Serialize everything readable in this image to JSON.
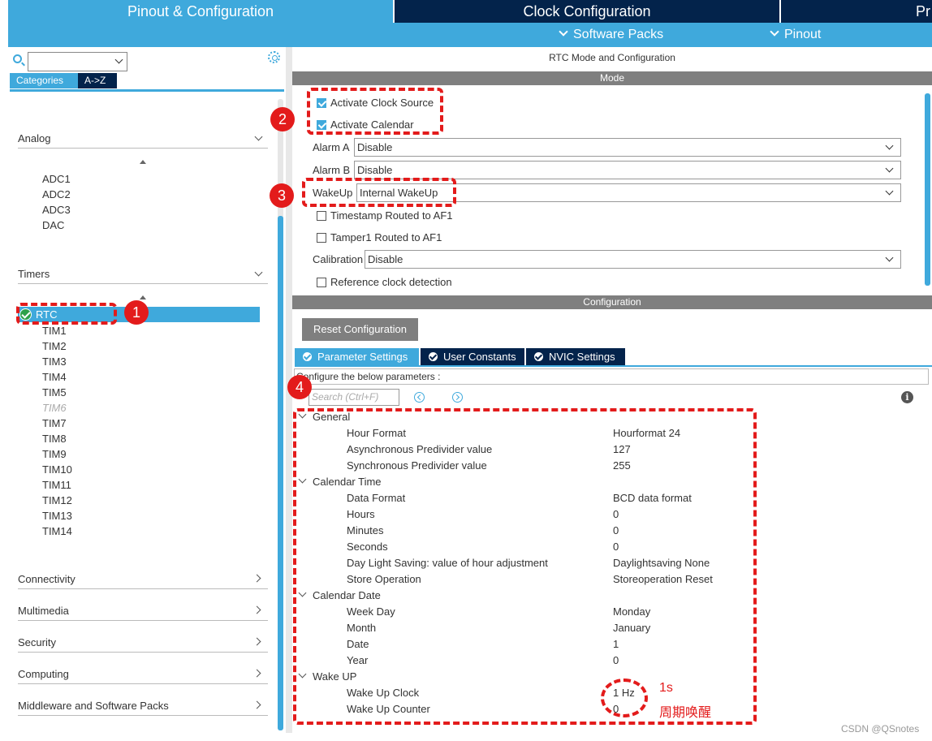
{
  "top_tabs": [
    "Pinout & Configuration",
    "Clock Configuration",
    "Pr"
  ],
  "subbar": {
    "software_packs": "Software Packs",
    "pinout": "Pinout"
  },
  "left": {
    "cat_tabs": [
      "Categories",
      "A->Z"
    ],
    "groups": {
      "analog": "Analog",
      "timers": "Timers",
      "connectivity": "Connectivity",
      "multimedia": "Multimedia",
      "security": "Security",
      "computing": "Computing",
      "middleware": "Middleware and Software Packs"
    },
    "analog_items": [
      "ADC1",
      "ADC2",
      "ADC3",
      "DAC"
    ],
    "timer_selected": "RTC",
    "timer_items": [
      "TIM1",
      "TIM2",
      "TIM3",
      "TIM4",
      "TIM5",
      "TIM6",
      "TIM7",
      "TIM8",
      "TIM9",
      "TIM10",
      "TIM11",
      "TIM12",
      "TIM13",
      "TIM14"
    ]
  },
  "right": {
    "title": "RTC Mode and Configuration",
    "mode_header": "Mode",
    "activate_clock": "Activate Clock Source",
    "activate_calendar": "Activate Calendar",
    "alarm_a": {
      "label": "Alarm A",
      "value": "Disable"
    },
    "alarm_b": {
      "label": "Alarm B",
      "value": "Disable"
    },
    "wakeup": {
      "label": "WakeUp",
      "value": "Internal WakeUp"
    },
    "timestamp": "Timestamp Routed to AF1",
    "tamper": "Tamper1 Routed to AF1",
    "calibration": {
      "label": "Calibration",
      "value": "Disable"
    },
    "refclock": "Reference clock detection",
    "config_header": "Configuration",
    "reset_button": "Reset Configuration",
    "param_tabs": [
      "Parameter Settings",
      "User Constants",
      "NVIC Settings"
    ],
    "hint": "Configure the below parameters :",
    "search_placeholder": "Search (Ctrl+F)",
    "params": [
      {
        "group": "General"
      },
      {
        "name": "Hour Format",
        "value": "Hourformat 24"
      },
      {
        "name": "Asynchronous Predivider value",
        "value": "127"
      },
      {
        "name": "Synchronous Predivider value",
        "value": "255"
      },
      {
        "group": "Calendar Time"
      },
      {
        "name": "Data Format",
        "value": "BCD data format"
      },
      {
        "name": "Hours",
        "value": "0"
      },
      {
        "name": "Minutes",
        "value": "0"
      },
      {
        "name": "Seconds",
        "value": "0"
      },
      {
        "name": "Day Light Saving: value of hour adjustment",
        "value": "Daylightsaving None"
      },
      {
        "name": "Store Operation",
        "value": "Storeoperation Reset"
      },
      {
        "group": "Calendar Date"
      },
      {
        "name": "Week Day",
        "value": "Monday"
      },
      {
        "name": "Month",
        "value": "January"
      },
      {
        "name": "Date",
        "value": "1"
      },
      {
        "name": "Year",
        "value": "0"
      },
      {
        "group": "Wake UP"
      },
      {
        "name": "Wake Up Clock",
        "value": "1 Hz"
      },
      {
        "name": "Wake Up Counter",
        "value": "0"
      }
    ]
  },
  "annotations": {
    "b1": "1",
    "b2": "2",
    "b3": "3",
    "b4": "4",
    "note1": "1s",
    "note2": "周期唤醒"
  },
  "watermark": "CSDN @QSnotes"
}
